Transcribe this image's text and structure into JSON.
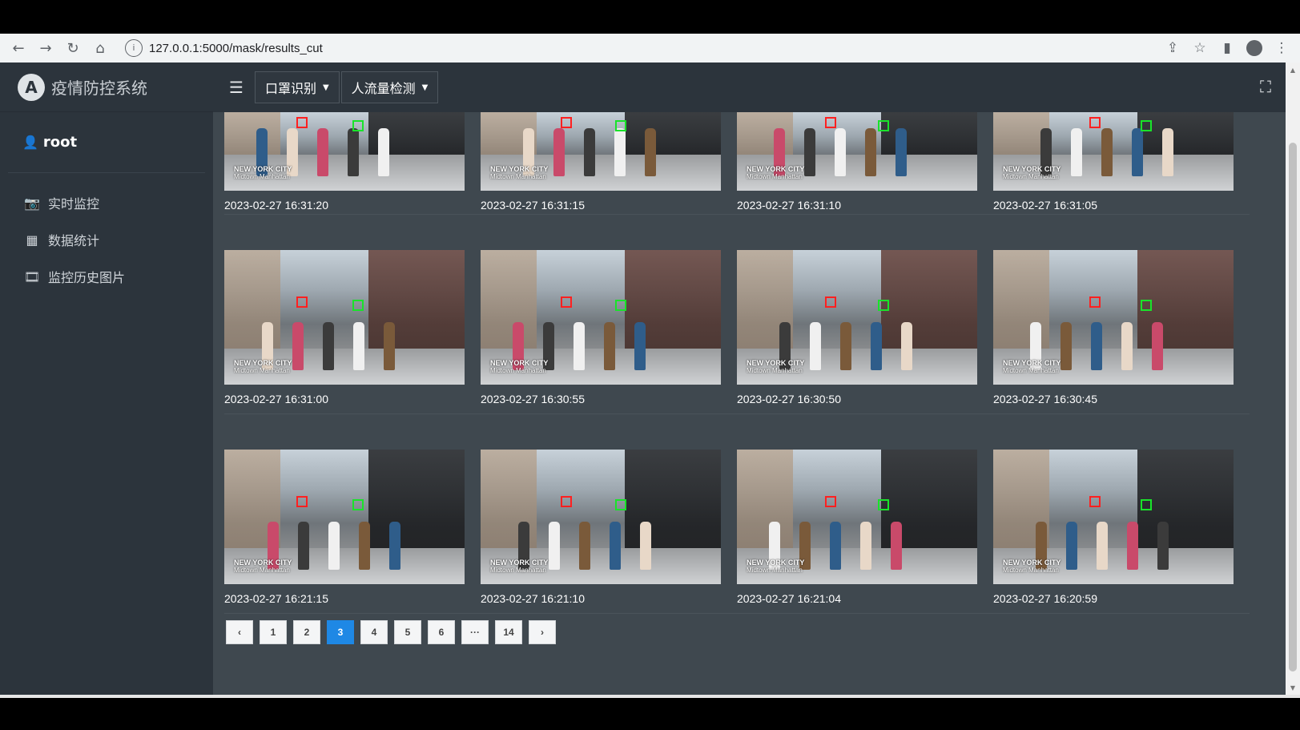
{
  "browser": {
    "url": "127.0.0.1:5000/mask/results_cut"
  },
  "app": {
    "brand": "疫情防控系统",
    "user": "root",
    "menu": [
      {
        "label": "实时监控",
        "icon": "camera-icon"
      },
      {
        "label": "数据统计",
        "icon": "calculator-icon"
      },
      {
        "label": "监控历史图片",
        "icon": "film-icon"
      }
    ],
    "topbar": {
      "dropdown1": "口罩识别",
      "dropdown2": "人流量检测"
    }
  },
  "gallery": {
    "rows": [
      [
        "2023-02-27 16:31:20",
        "2023-02-27 16:31:15",
        "2023-02-27 16:31:10",
        "2023-02-27 16:31:05"
      ],
      [
        "2023-02-27 16:31:00",
        "2023-02-27 16:30:55",
        "2023-02-27 16:30:50",
        "2023-02-27 16:30:45"
      ],
      [
        "2023-02-27 16:21:15",
        "2023-02-27 16:21:10",
        "2023-02-27 16:21:04",
        "2023-02-27 16:20:59"
      ]
    ],
    "caption_title": "NEW YORK CITY",
    "caption_sub": "Midtown Manhattan"
  },
  "pagination": {
    "prev": "‹",
    "pages": [
      "1",
      "2",
      "3",
      "4",
      "5",
      "6",
      "···",
      "14"
    ],
    "next": "›",
    "active": "3"
  }
}
